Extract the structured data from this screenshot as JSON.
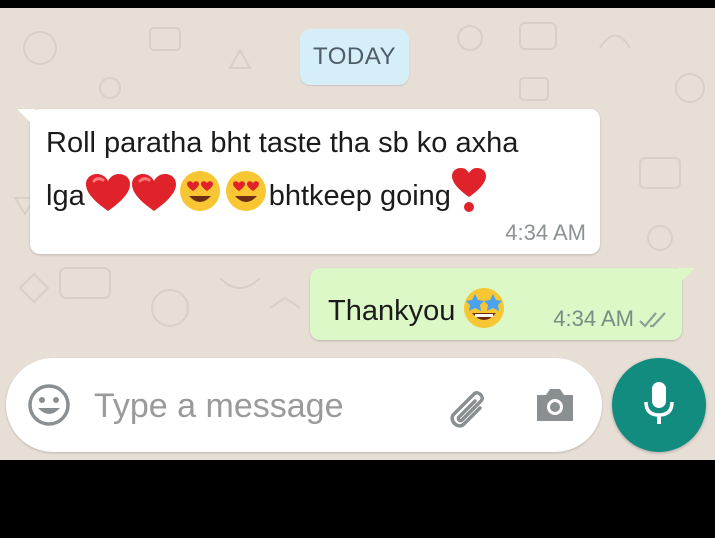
{
  "chat": {
    "date_chip": "TODAY",
    "messages": [
      {
        "direction": "incoming",
        "text_line1": "Roll paratha bht taste tha sb ko axha",
        "text_line2_prefix": "lga",
        "emojis": [
          "red-heart",
          "red-heart",
          "heart-eyes-face",
          "heart-eyes-face"
        ],
        "text_line2_suffix": "bhtkeep going",
        "trailing_emoji": "heart-exclamation",
        "time": "4:34 AM"
      },
      {
        "direction": "outgoing",
        "text": "Thankyou",
        "emoji": "star-struck-face",
        "time": "4:34 AM",
        "status": "delivered-double-tick"
      }
    ]
  },
  "composer": {
    "placeholder": "Type a message",
    "value": ""
  },
  "colors": {
    "chat_background": "#e7ded6",
    "incoming_bubble": "#ffffff",
    "outgoing_bubble": "#dcf8c6",
    "date_chip": "#d5eef7",
    "mic_button": "#128c7e"
  }
}
